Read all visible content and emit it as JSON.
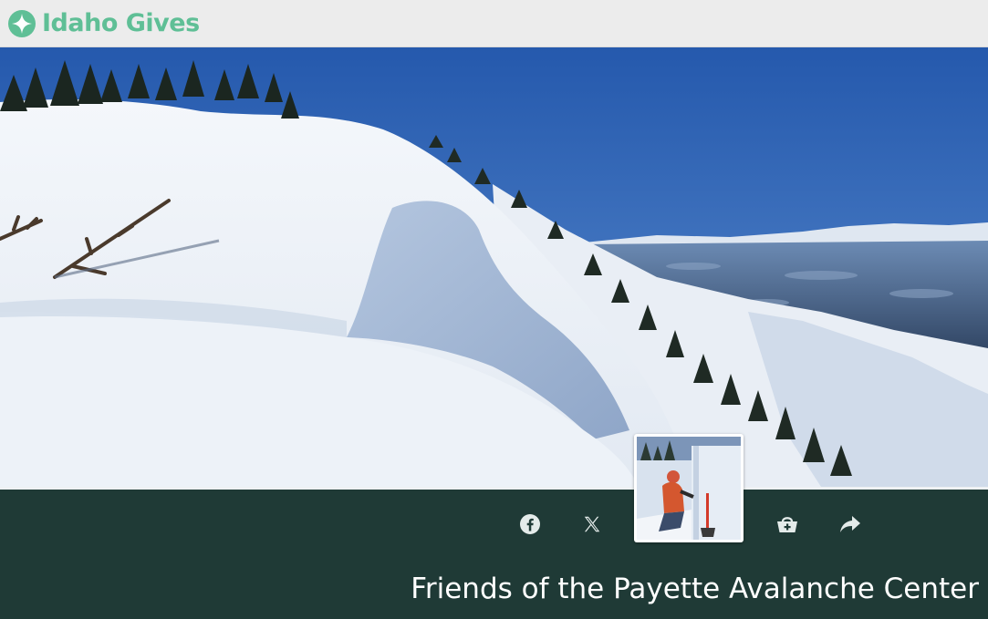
{
  "header": {
    "brand": "Idaho Gives",
    "logo_icon": "star-circle-icon",
    "brand_color": "#5fbf96"
  },
  "hero": {
    "image_subject": "snow-covered-ridge-with-cornice-and-distant-mountains"
  },
  "profile": {
    "thumbnail_subject": "person-digging-snow-pit-with-shovel"
  },
  "share_bar": {
    "buttons": [
      {
        "icon": "facebook-icon"
      },
      {
        "icon": "x-twitter-icon"
      },
      {
        "icon": "basket-add-icon"
      },
      {
        "icon": "share-arrow-icon"
      }
    ]
  },
  "organization": {
    "name": "Friends of the Payette Avalanche Center"
  },
  "colors": {
    "band_background": "#1f3a36",
    "header_background": "#ececec",
    "accent": "#5fbf96"
  }
}
